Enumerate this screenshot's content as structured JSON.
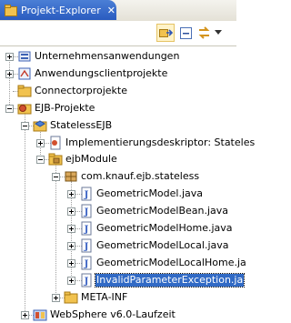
{
  "view": {
    "title": "Projekt-Explorer",
    "close_glyph": "✕"
  },
  "toolbar": {
    "buttons": [
      "link-with-editor-icon",
      "collapse-all-icon",
      "sync-icon",
      "view-menu-chevron-icon"
    ]
  },
  "tree": [
    {
      "label": "Unternehmensanwendungen",
      "icon": "enterprise-app-icon",
      "expander": "plus"
    },
    {
      "label": "Anwendungsclientprojekte",
      "icon": "app-client-icon",
      "expander": "plus"
    },
    {
      "label": "Connectorprojekte",
      "icon": "connector-folder-icon",
      "expander": "none"
    },
    {
      "label": "EJB-Projekte",
      "icon": "ejb-projects-icon",
      "expander": "minus"
    },
    {
      "label": "StatelessEJB",
      "icon": "ejb-project-icon",
      "expander": "minus"
    },
    {
      "label": "Implementierungsdeskriptor: Stateles",
      "icon": "deployment-descriptor-icon",
      "expander": "plus"
    },
    {
      "label": "ejbModule",
      "icon": "source-folder-icon",
      "expander": "minus"
    },
    {
      "label": "com.knauf.ejb.stateless",
      "icon": "package-icon",
      "expander": "minus"
    },
    {
      "label": "GeometricModel.java",
      "icon": "java-file-icon",
      "expander": "plus"
    },
    {
      "label": "GeometricModelBean.java",
      "icon": "java-file-icon",
      "expander": "plus"
    },
    {
      "label": "GeometricModelHome.java",
      "icon": "java-file-icon",
      "expander": "plus"
    },
    {
      "label": "GeometricModelLocal.java",
      "icon": "java-file-icon",
      "expander": "plus"
    },
    {
      "label": "GeometricModelLocalHome.ja",
      "icon": "java-file-icon",
      "expander": "plus"
    },
    {
      "label": "InvalidParameterException.ja",
      "icon": "java-file-icon",
      "expander": "plus"
    },
    {
      "label": "META-INF",
      "icon": "folder-icon",
      "expander": "plus"
    },
    {
      "label": "WebSphere v6.0-Laufzeit",
      "icon": "websphere-runtime-icon",
      "expander": "plus"
    }
  ],
  "selected_index": 13,
  "colors": {
    "title_bar": "#2a5bbf",
    "selection": "#316ac5",
    "java_icon": "#3f66c5",
    "package_icon": "#c08a3a",
    "folder_icon": "#f1c24f"
  }
}
